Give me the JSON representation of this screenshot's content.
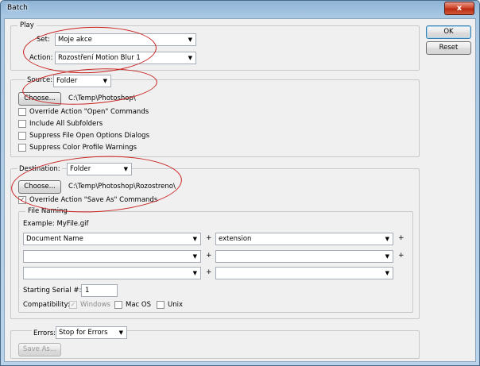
{
  "window": {
    "title": "Batch",
    "close_glyph": "x",
    "annotation_color": "#c8201e"
  },
  "buttons": {
    "ok": "OK",
    "reset": "Reset"
  },
  "play": {
    "legend": "Play",
    "set_label": "Set:",
    "set_value": "Moje akce",
    "action_label": "Action:",
    "action_value": "Rozostření Motion Blur 1"
  },
  "source": {
    "label": "Source:",
    "value": "Folder",
    "choose_label": "Choose...",
    "path": "C:\\Temp\\Photoshop\\",
    "options": [
      {
        "label": "Override Action \"Open\" Commands",
        "checked": false
      },
      {
        "label": "Include All Subfolders",
        "checked": false
      },
      {
        "label": "Suppress File Open Options Dialogs",
        "checked": false
      },
      {
        "label": "Suppress Color Profile Warnings",
        "checked": false
      }
    ]
  },
  "destination": {
    "label": "Destination:",
    "value": "Folder",
    "choose_label": "Choose...",
    "path": "C:\\Temp\\Photoshop\\Rozostreno\\",
    "override_label": "Override Action \"Save As\" Commands",
    "override_checked": true
  },
  "file_naming": {
    "legend": "File Naming",
    "example": "Example: MyFile.gif",
    "fields": [
      {
        "value": "Document Name"
      },
      {
        "value": "extension"
      },
      {
        "value": ""
      },
      {
        "value": ""
      },
      {
        "value": ""
      },
      {
        "value": ""
      }
    ],
    "plus": "+",
    "serial_label": "Starting Serial #:",
    "serial_value": "1",
    "compat_label": "Compatibility:",
    "compat_windows": "Windows",
    "compat_mac": "Mac OS",
    "compat_unix": "Unix"
  },
  "errors": {
    "label": "Errors:",
    "value": "Stop for Errors",
    "save_as_label": "Save As..."
  }
}
